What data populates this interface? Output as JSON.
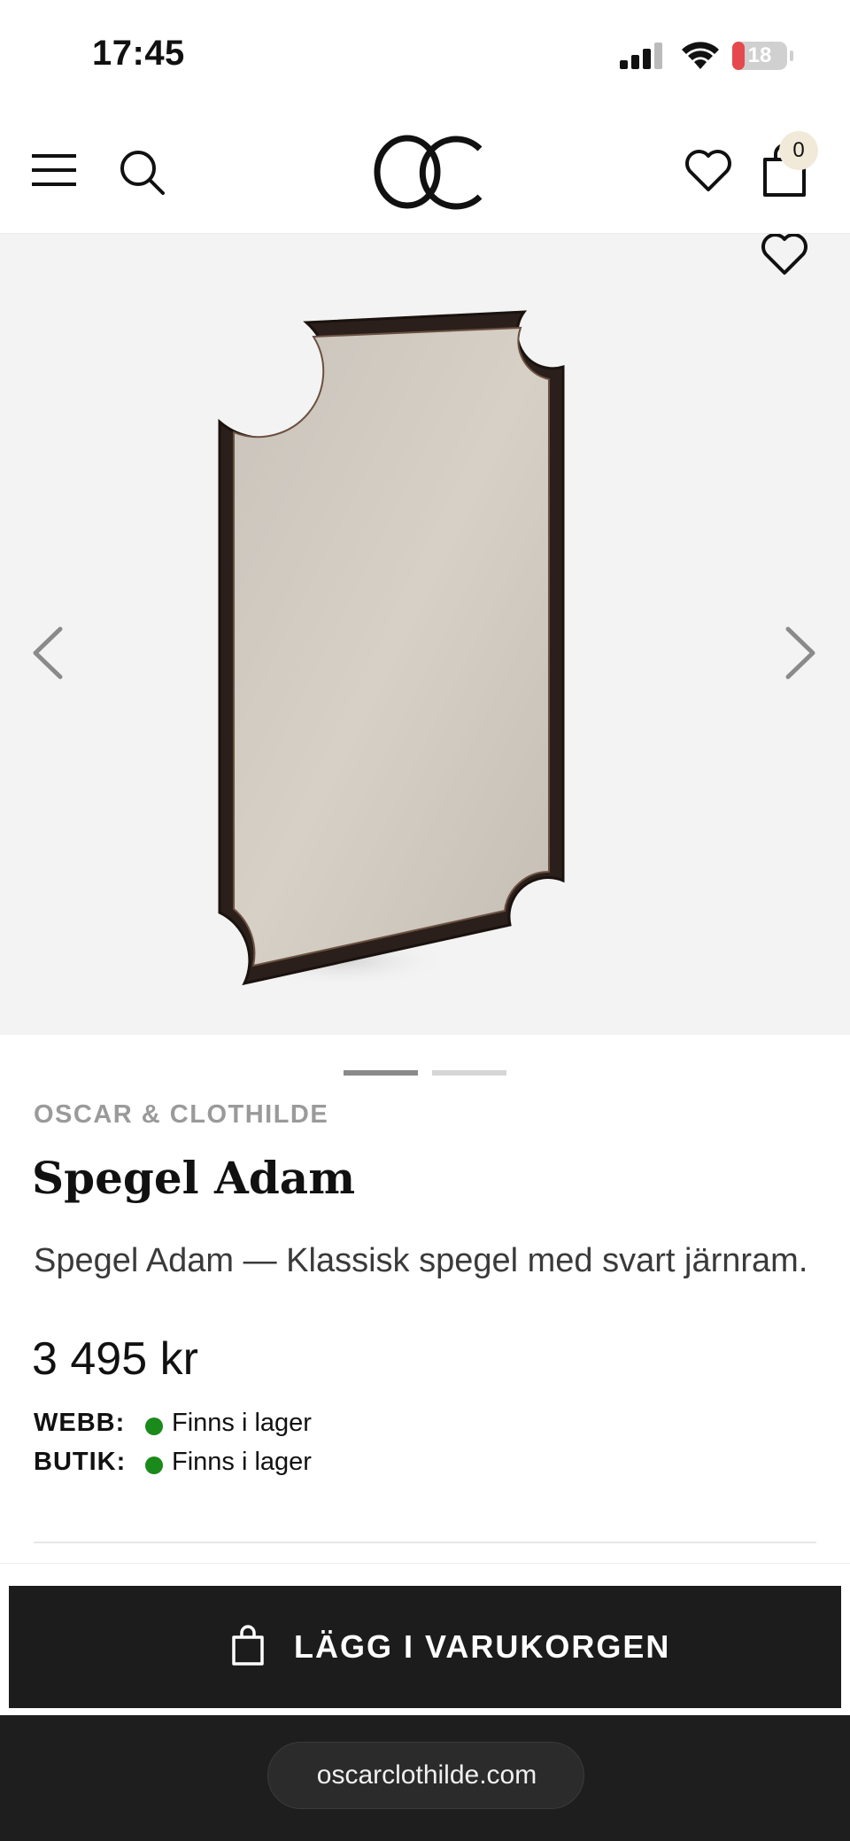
{
  "status_bar": {
    "time": "17:45",
    "battery_level": "18",
    "icons": [
      "signal-icon",
      "wifi-icon",
      "battery-icon"
    ]
  },
  "header": {
    "logo_text": "OC",
    "cart_count": "0",
    "icons": [
      "menu-icon",
      "search-icon",
      "heart-icon",
      "shopping-bag-icon"
    ]
  },
  "gallery": {
    "image_count": 2,
    "active_index": 1,
    "icons": [
      "heart-icon",
      "chevron-left-icon",
      "chevron-right-icon"
    ]
  },
  "product": {
    "brand": "OSCAR & CLOTHILDE",
    "title": "Spegel Adam",
    "description": "Spegel Adam — Klassisk spegel med svart järnram.",
    "price": "3 495 kr",
    "stock": [
      {
        "label": "WEBB:",
        "status": "Finns i lager"
      },
      {
        "label": "BUTIK:",
        "status": "Finns i lager"
      }
    ]
  },
  "actions": {
    "add_to_cart_label": "LÄGG I VARUKORGEN"
  },
  "browser": {
    "url": "oscarclothilde.com"
  },
  "colors": {
    "in_stock": "#1a8a1a",
    "button_bg": "#1c1c1c",
    "cart_badge": "#f1ead9"
  }
}
